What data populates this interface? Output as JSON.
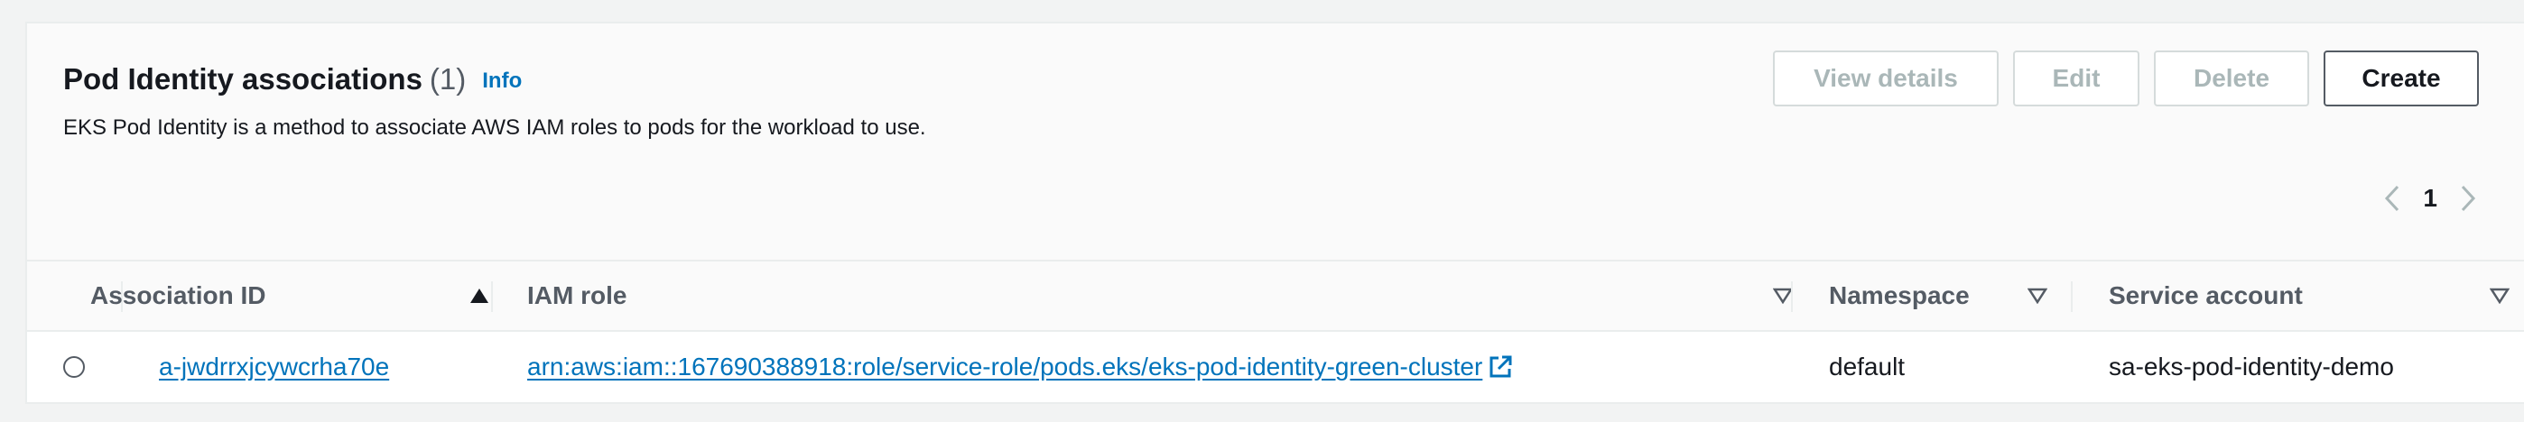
{
  "section": {
    "title": "Pod Identity associations",
    "count": "(1)",
    "info_label": "Info",
    "description": "EKS Pod Identity is a method to associate AWS IAM roles to pods for the workload to use."
  },
  "actions": {
    "view_details": "View details",
    "edit": "Edit",
    "delete": "Delete",
    "create": "Create"
  },
  "pagination": {
    "current_page": "1"
  },
  "table": {
    "columns": [
      "Association ID",
      "IAM role",
      "Namespace",
      "Service account"
    ],
    "rows": [
      {
        "association_id": "a-jwdrrxjcywcrha70e",
        "iam_role": "arn:aws:iam::167690388918:role/service-role/pods.eks/eks-pod-identity-green-cluster",
        "namespace": "default",
        "service_account": "sa-eks-pod-identity-demo"
      }
    ]
  },
  "colors": {
    "link": "#0073bb",
    "disabled_text": "#aab7b8",
    "primary_text": "#16191f",
    "secondary_text": "#545b64"
  }
}
